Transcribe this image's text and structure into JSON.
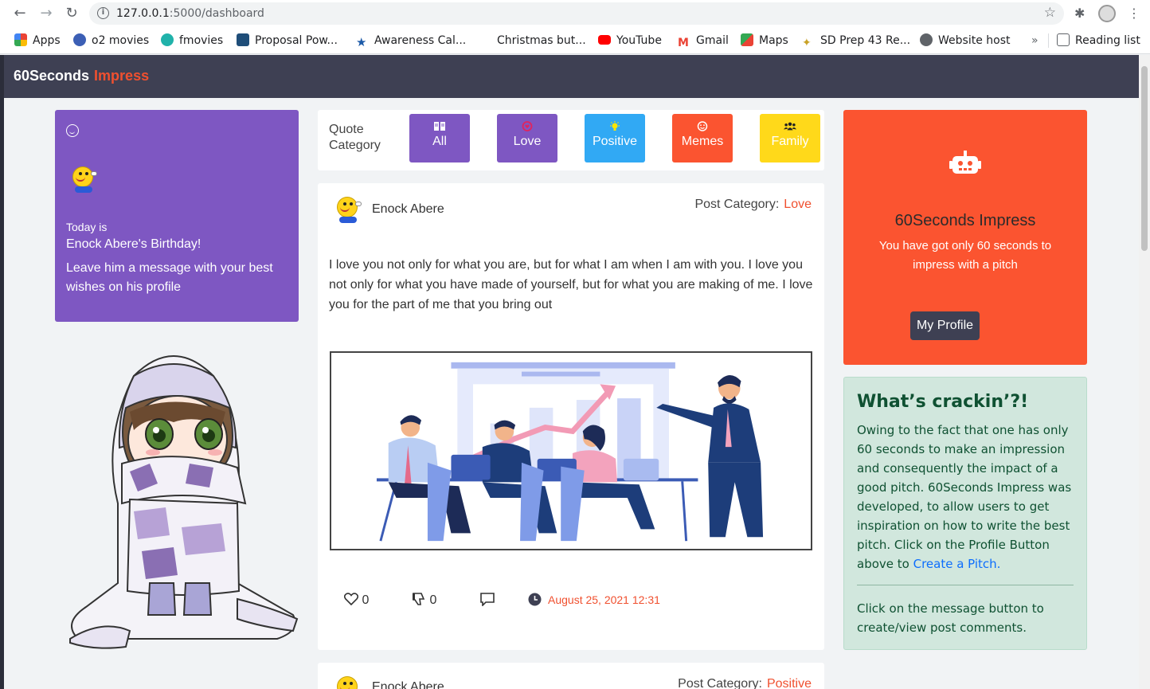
{
  "browser": {
    "url_host": "127.0.0.1",
    "url_path": ":5000/dashboard",
    "bookmarks": [
      {
        "label": "Apps",
        "color": "#ea4335"
      },
      {
        "label": "o2 movies",
        "color": "#3c5fb5"
      },
      {
        "label": "fmovies",
        "color": "#20b2aa"
      },
      {
        "label": "Proposal Pow...",
        "color": "#1f4e79"
      },
      {
        "label": "Awareness Cal...",
        "color": "#1c5aa8"
      },
      {
        "label": "Christmas but...",
        "color": "#ffffff"
      },
      {
        "label": "YouTube",
        "color": "#ff0000"
      },
      {
        "label": "Gmail",
        "color": "#ea4335"
      },
      {
        "label": "Maps",
        "color": "#34a853"
      },
      {
        "label": "SD Prep 43 Re...",
        "color": "#c9a227"
      },
      {
        "label": "Website host",
        "color": "#5f6368"
      }
    ],
    "more": "»",
    "reading_list": "Reading list"
  },
  "nav": {
    "brand": "60Seconds",
    "brand_accent": "Impress"
  },
  "birthday": {
    "today": "Today is",
    "who": "Enock Abere's Birthday!",
    "message": "Leave him a message with your best wishes on his profile"
  },
  "categories": {
    "label": "Quote Category",
    "items": [
      {
        "label": "All",
        "color": "#7e57c2",
        "icon": "book-icon"
      },
      {
        "label": "Love",
        "color": "#7e57c2",
        "icon": "heart-icon"
      },
      {
        "label": "Positive",
        "color": "#31a9f4",
        "icon": "lightbulb-icon"
      },
      {
        "label": "Memes",
        "color": "#fb5430",
        "icon": "smile-icon"
      },
      {
        "label": "Family",
        "color": "#ffd91a",
        "icon": "users-icon"
      }
    ]
  },
  "post": {
    "author": "Enock Abere",
    "category_label": "Post Category:",
    "category": "Love",
    "body": "I love you not only for what you are, but for what I am when I am with you. I love you not only for what you have made of yourself, but for what you are making of me. I love you for the part of me that you bring out",
    "likes": "0",
    "dislikes": "0",
    "date": "August 25, 2021 12:31"
  },
  "post2": {
    "author": "Enock Abere",
    "category_label": "Post Category:",
    "category": "Positive"
  },
  "promo": {
    "title": "60Seconds Impress",
    "text": "You have got only 60 seconds to impress with a pitch",
    "button": "My Profile"
  },
  "info": {
    "title": "What’s crackin’?!",
    "body": "Owing to the fact that one has only 60 seconds to make an impression and consequently the impact of a good pitch. 60Seconds Impress was developed, to allow users to get inspiration on how to write the best pitch. Click on the Profile Button above to ",
    "link": "Create a Pitch.",
    "note": "Click on the message button to create/view post comments."
  }
}
